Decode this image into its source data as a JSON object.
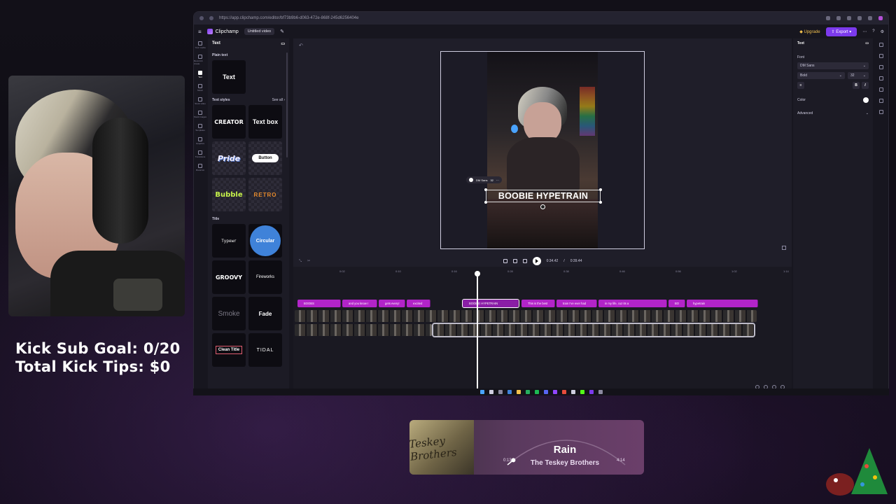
{
  "stream": {
    "sub_goal": "Kick Sub Goal: 0/20",
    "tips": "Total Kick Tips: $0"
  },
  "browser": {
    "url": "https://app.clipchamp.com/editor/bf73b9b6-d063-472e-868f-245d6256404e"
  },
  "app": {
    "brand": "Clipchamp",
    "doc_title": "Untitled video",
    "upgrade": "Upgrade",
    "export": "Export"
  },
  "rail": [
    {
      "icon": "media-icon",
      "label": "Your media"
    },
    {
      "icon": "record-icon",
      "label": "Record & create"
    },
    {
      "icon": "text-icon",
      "label": "Text"
    },
    {
      "icon": "music-icon",
      "label": "Music"
    },
    {
      "icon": "stock-video-icon",
      "label": "Stock video"
    },
    {
      "icon": "stock-images-icon",
      "label": "Stock images"
    },
    {
      "icon": "templates-icon",
      "label": "Templates"
    },
    {
      "icon": "graphics-icon",
      "label": "Graphics"
    },
    {
      "icon": "transitions-icon",
      "label": "Transitions"
    },
    {
      "icon": "brand-kit-icon",
      "label": "Brand kit"
    }
  ],
  "text_panel": {
    "header": "Text",
    "plain_text_section": "Plain text",
    "plain_text_tile": "Text",
    "styles_section": "Text styles",
    "see_all": "See all",
    "styles": [
      "CREATOR",
      "Text box",
      "Pride",
      "Button",
      "Bubble",
      "RETRO"
    ],
    "title_section": "Title",
    "titles": [
      "Typewr",
      "Circular",
      "GROOVY",
      "Fireworks",
      "Smoke",
      "Fade",
      "Clean Title",
      "TIDAL"
    ]
  },
  "stage": {
    "overlay_text": "BOOBIE HYPETRAIN",
    "mini_font": "DM Sans",
    "mini_size": "32"
  },
  "playback": {
    "current": "0:34.42",
    "total": "0:39.44"
  },
  "timeline": {
    "ruler": [
      "0:02",
      "0:10",
      "0:16",
      "0:24",
      "0:28",
      "0:32",
      "0:38",
      "0:46",
      "0:50",
      "0:56",
      "1:02",
      "1:08",
      "1:14"
    ],
    "text_clips": [
      {
        "label": "BOOBS"
      },
      {
        "label": "and you know I"
      },
      {
        "label": "gets every!"
      },
      {
        "label": "excited"
      },
      {
        "label": "BOOBIE HYPETRAIN"
      },
      {
        "label": "This is the best"
      },
      {
        "label": "train I've ever had"
      },
      {
        "label": "in my life, cuz its a"
      },
      {
        "label": "BO"
      },
      {
        "label": "hypetrain"
      }
    ]
  },
  "props": {
    "header": "Text",
    "font_label": "Font",
    "font_value": "DM Sans",
    "weight_value": "Bold",
    "size_value": "32",
    "bold_btn": "B",
    "italic_btn": "I",
    "color_label": "Color",
    "advanced_label": "Advanced"
  },
  "now_playing": {
    "title": "Rain",
    "artist": "The Teskey Brothers",
    "elapsed": "0:13",
    "duration": "4:14",
    "progress": 0.05,
    "album_art_text": "Teskey Brothers"
  },
  "colors": {
    "accent": "#7c3aed",
    "text_clip": "#b224c9",
    "upgrade": "#f2c14e"
  }
}
